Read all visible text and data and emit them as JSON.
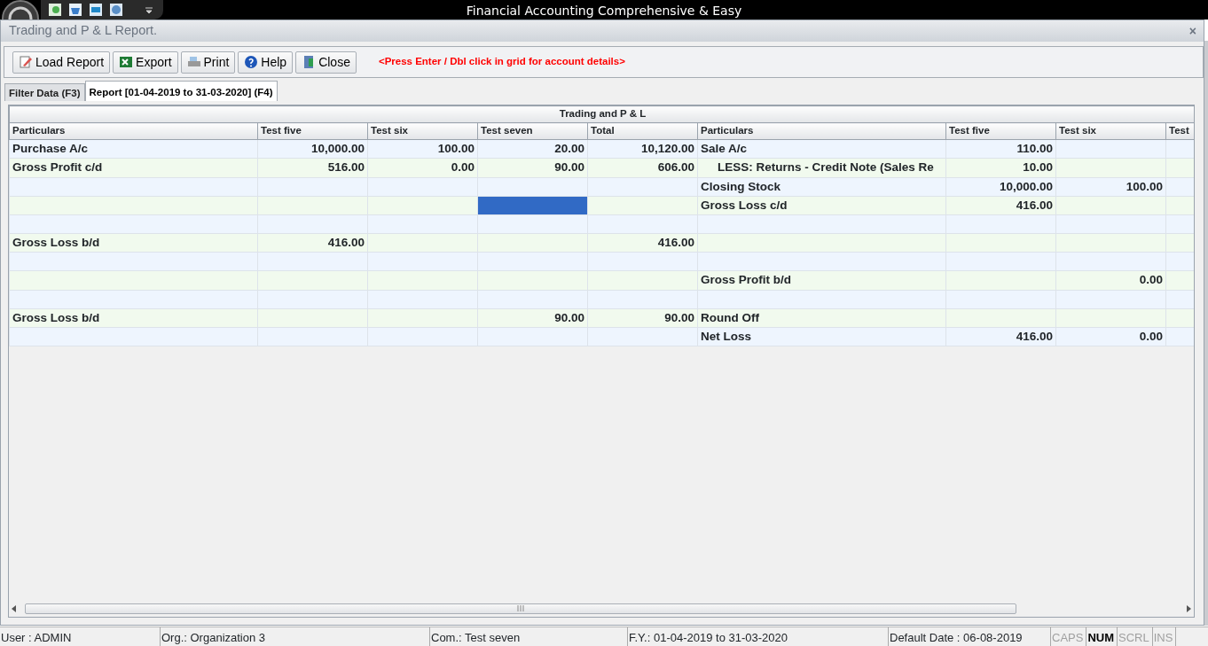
{
  "app_title": "Financial Accounting Comprehensive & Easy",
  "window": {
    "title": "Trading and P & L Report.",
    "close": "×"
  },
  "toolbar": {
    "buttons": [
      {
        "kind": "load",
        "label": "Load Report"
      },
      {
        "kind": "export",
        "label": "Export"
      },
      {
        "kind": "print",
        "label": "Print"
      },
      {
        "kind": "help",
        "label": "Help"
      },
      {
        "kind": "close",
        "label": "Close"
      }
    ],
    "hint": "<Press Enter / Dbl click in grid for account details>"
  },
  "tabs": [
    {
      "label": "Filter Data (F3)",
      "selected": false
    },
    {
      "label": "Report [01-04-2019 to 31-03-2020] (F4)",
      "selected": true
    }
  ],
  "table": {
    "title": "Trading and P & L",
    "columns": [
      "Particulars",
      "Test five",
      "Test six",
      "Test seven",
      "Total",
      "Particulars",
      "Test five",
      "Test six",
      "Test"
    ],
    "rows": [
      {
        "cells": [
          "Purchase A/c",
          "10,000.00",
          "100.00",
          "20.00",
          "10,120.00",
          "Sale A/c",
          "110.00",
          null,
          null
        ],
        "selected": [
          false,
          false,
          false,
          false,
          false,
          false,
          false,
          false,
          false
        ],
        "right_indented": false
      },
      {
        "cells": [
          "Gross Profit c/d",
          "516.00",
          "0.00",
          "90.00",
          "606.00",
          "LESS: Returns - Credit Note (Sales Re",
          "10.00",
          null,
          null
        ],
        "selected": [
          false,
          false,
          false,
          false,
          false,
          false,
          false,
          false,
          false
        ],
        "right_indented": true
      },
      {
        "cells": [
          null,
          null,
          null,
          null,
          null,
          "Closing Stock",
          "10,000.00",
          "100.00",
          null
        ],
        "selected": [
          false,
          false,
          false,
          false,
          false,
          false,
          false,
          false,
          false
        ],
        "right_indented": false
      },
      {
        "cells": [
          null,
          null,
          null,
          null,
          null,
          "Gross Loss c/d",
          "416.00",
          null,
          null
        ],
        "selected": [
          false,
          false,
          false,
          true,
          false,
          false,
          false,
          false,
          false
        ],
        "right_indented": false
      },
      {
        "cells": [
          null,
          null,
          null,
          null,
          null,
          null,
          null,
          null,
          null
        ],
        "selected": [
          false,
          false,
          false,
          false,
          false,
          false,
          false,
          false,
          false
        ]
      },
      {
        "cells": [
          "Gross Loss b/d",
          "416.00",
          null,
          null,
          "416.00",
          null,
          null,
          null,
          null
        ],
        "selected": [
          false,
          false,
          false,
          false,
          false,
          false,
          false,
          false,
          false
        ]
      },
      {
        "cells": [
          null,
          null,
          null,
          null,
          null,
          null,
          null,
          null,
          null
        ],
        "selected": [
          false,
          false,
          false,
          false,
          false,
          false,
          false,
          false,
          false
        ]
      },
      {
        "cells": [
          null,
          null,
          null,
          null,
          null,
          "Gross Profit b/d",
          null,
          "0.00",
          null
        ],
        "selected": [
          false,
          false,
          false,
          false,
          false,
          false,
          false,
          false,
          false
        ],
        "right_indented": false
      },
      {
        "cells": [
          null,
          null,
          null,
          null,
          null,
          null,
          null,
          null,
          null
        ],
        "selected": [
          false,
          false,
          false,
          false,
          false,
          false,
          false,
          false,
          false
        ]
      },
      {
        "cells": [
          "Gross Loss b/d",
          null,
          null,
          "90.00",
          "90.00",
          "Round Off",
          null,
          null,
          null
        ],
        "selected": [
          false,
          false,
          false,
          false,
          false,
          false,
          false,
          false,
          false
        ],
        "right_indented": false
      },
      {
        "cells": [
          null,
          null,
          null,
          null,
          null,
          "Net Loss",
          "416.00",
          "0.00",
          null
        ],
        "selected": [
          false,
          false,
          false,
          false,
          false,
          false,
          false,
          false,
          false
        ],
        "right_indented": false
      }
    ]
  },
  "status_bar": [
    {
      "kind": "text",
      "text": "User : ADMIN"
    },
    {
      "kind": "text",
      "text": "Org.: Organization 3"
    },
    {
      "kind": "text",
      "text": "Com.: Test seven"
    },
    {
      "kind": "text",
      "text": "F.Y.: 01-04-2019 to 31-03-2020"
    },
    {
      "kind": "text",
      "text": "Default Date : 06-08-2019"
    },
    {
      "kind": "key",
      "text": "CAPS",
      "on": false
    },
    {
      "kind": "key",
      "text": "NUM",
      "on": true
    },
    {
      "kind": "key",
      "text": "SCRL",
      "on": false
    },
    {
      "kind": "key",
      "text": "INS",
      "on": false
    }
  ]
}
